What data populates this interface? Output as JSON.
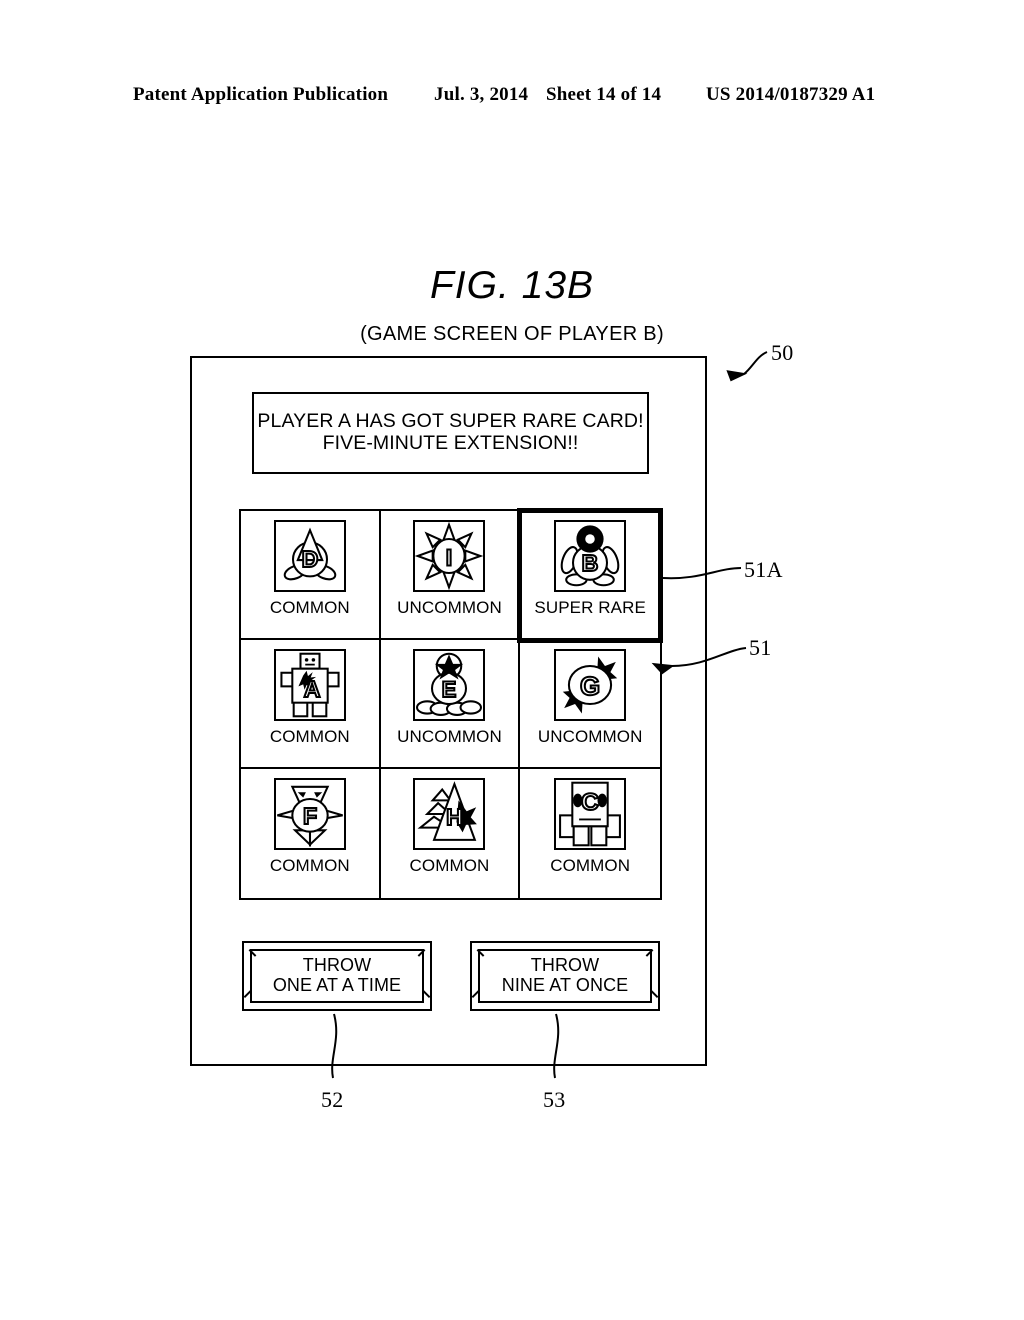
{
  "header": {
    "publication": "Patent Application Publication",
    "date": "Jul. 3, 2014",
    "sheet": "Sheet 14 of 14",
    "number": "US 2014/0187329 A1"
  },
  "figure": {
    "title": "FIG. 13B",
    "subtitle": "(GAME SCREEN OF PLAYER B)"
  },
  "screen": {
    "message": {
      "line1": "PLAYER A HAS GOT SUPER RARE CARD!",
      "line2": "FIVE-MINUTE EXTENSION!!"
    },
    "cards": [
      {
        "letter": "D",
        "rarity": "COMMON",
        "art": "cone-hat-creature-icon",
        "selected": false
      },
      {
        "letter": "I",
        "rarity": "UNCOMMON",
        "art": "spiked-sun-icon",
        "selected": false
      },
      {
        "letter": "B",
        "rarity": "SUPER RARE",
        "art": "penguin-creature-icon",
        "selected": true
      },
      {
        "letter": "A",
        "rarity": "COMMON",
        "art": "robot-icon",
        "selected": false
      },
      {
        "letter": "E",
        "rarity": "UNCOMMON",
        "art": "star-head-creature-icon",
        "selected": false
      },
      {
        "letter": "G",
        "rarity": "UNCOMMON",
        "art": "winged-orb-icon",
        "selected": false
      },
      {
        "letter": "F",
        "rarity": "COMMON",
        "art": "winged-creature-icon",
        "selected": false
      },
      {
        "letter": "H",
        "rarity": "COMMON",
        "art": "spiked-tree-icon",
        "selected": false
      },
      {
        "letter": "C",
        "rarity": "COMMON",
        "art": "boxy-creature-icon",
        "selected": false
      }
    ],
    "buttons": {
      "throw_one": {
        "line1": "THROW",
        "line2": "ONE AT A TIME"
      },
      "throw_nine": {
        "line1": "THROW",
        "line2": "NINE AT ONCE"
      }
    }
  },
  "reference_numerals": {
    "screen": "50",
    "selected_card": "51A",
    "card_area": "51",
    "throw_one_button": "52",
    "throw_nine_button": "53"
  },
  "colors": {
    "ink": "#000000",
    "paper": "#ffffff"
  }
}
